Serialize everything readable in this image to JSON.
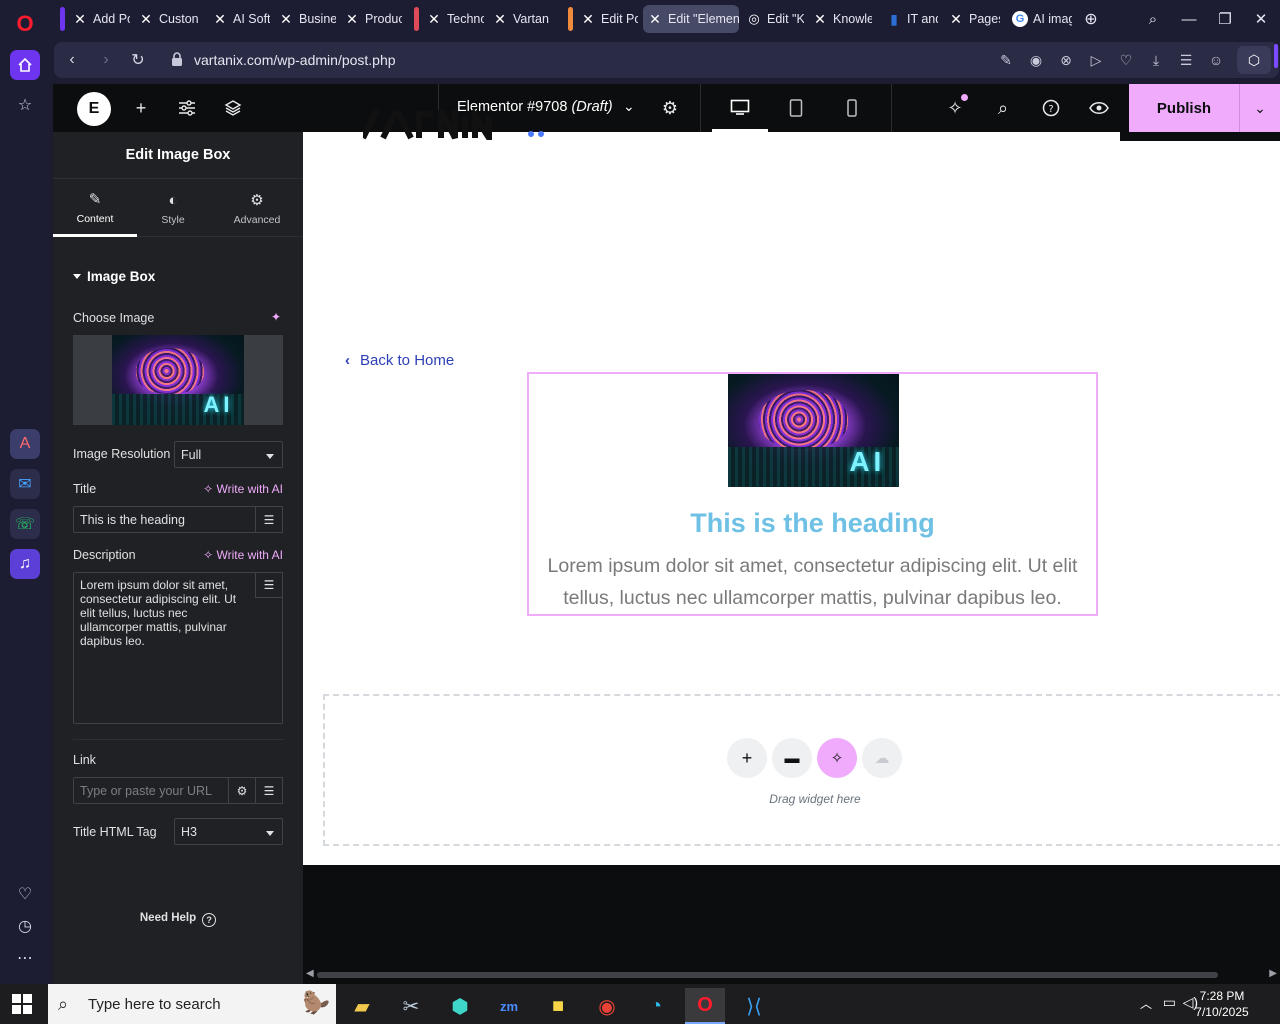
{
  "browser": {
    "tabs": [
      {
        "label": "Add Po",
        "icon": "x-favicon"
      },
      {
        "label": "Custon",
        "icon": "x-favicon"
      },
      {
        "label": "AI Soft",
        "icon": "x-favicon"
      },
      {
        "label": "Busine",
        "icon": "x-favicon"
      },
      {
        "label": "Produc",
        "icon": "x-favicon"
      },
      {
        "label": "Techno",
        "icon": "x-favicon"
      },
      {
        "label": "Vartan",
        "icon": "x-favicon"
      },
      {
        "label": "Edit Po",
        "icon": "x-favicon"
      },
      {
        "label": "Edit \"Elemen",
        "icon": "x-favicon"
      },
      {
        "label": "Edit \"K",
        "icon": "globe-favicon"
      },
      {
        "label": "Knowle",
        "icon": "x-favicon"
      },
      {
        "label": "IT and",
        "icon": "it-favicon"
      },
      {
        "label": "Pages",
        "icon": "x-favicon"
      },
      {
        "label": "AI imag",
        "icon": "google-favicon"
      }
    ],
    "url": "vartanix.com/wp-admin/post.php",
    "tab_group_colors": [
      "#e04b5a",
      "#f08b3c"
    ]
  },
  "editor": {
    "document_title": "Elementor #9708",
    "document_status": "(Draft)",
    "publish_label": "Publish",
    "accent_color": "#f0abfc"
  },
  "panel": {
    "title": "Edit Image Box",
    "tabs": [
      {
        "label": "Content",
        "icon": "pencil-icon",
        "active": true
      },
      {
        "label": "Style",
        "icon": "contrast-icon",
        "active": false
      },
      {
        "label": "Advanced",
        "icon": "gear-icon",
        "active": false
      }
    ],
    "section": "Image Box",
    "choose_image_label": "Choose Image",
    "image_resolution_label": "Image Resolution",
    "image_resolution_value": "Full",
    "title_label": "Title",
    "write_with_ai": "Write with AI",
    "title_value": "This is the heading",
    "description_label": "Description",
    "description_value": "Lorem ipsum dolor sit amet, consectetur adipiscing elit. Ut elit tellus, luctus nec ullamcorper mattis, pulvinar dapibus leo.",
    "link_label": "Link",
    "link_placeholder": "Type or paste your URL",
    "title_html_tag_label": "Title HTML Tag",
    "title_html_tag_value": "H3",
    "need_help": "Need Help",
    "thumb_text": "AI"
  },
  "canvas": {
    "back_link": "Back to Home",
    "image_text": "AI",
    "heading": "This is the heading",
    "description": "Lorem ipsum dolor sit amet, consectetur adipiscing elit. Ut elit tellus, luctus nec ullamcorper mattis, pulvinar dapibus leo.",
    "drag_hint": "Drag widget here",
    "heading_color": "#6ec1e4"
  },
  "taskbar": {
    "search_placeholder": "Type here to search",
    "time": "7:28 PM",
    "date": "7/10/2025"
  }
}
